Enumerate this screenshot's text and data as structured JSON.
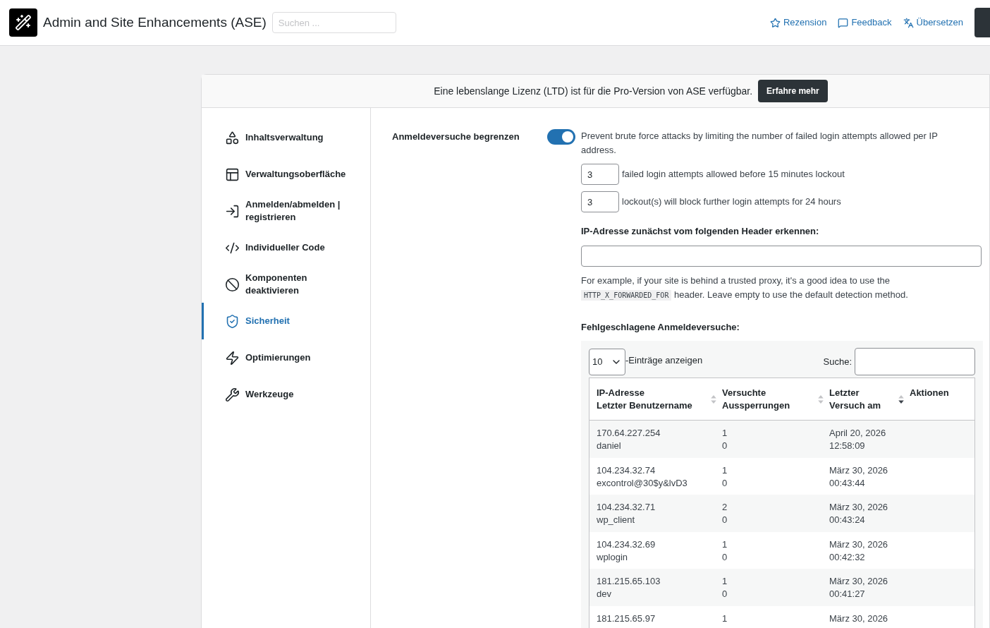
{
  "header": {
    "title": "Admin and Site Enhancements (ASE)",
    "search": {
      "placeholder": "Suchen ..."
    },
    "links": [
      "Rezension",
      "Feedback",
      "Übersetzen"
    ]
  },
  "banner": {
    "text": "Eine lebenslange Lizenz (LTD) ist für die Pro-Version von ASE verfügbar.",
    "button": "Erfahre mehr"
  },
  "sidebar": {
    "items": [
      {
        "label": "Inhaltsverwaltung",
        "selected": false
      },
      {
        "label": "Verwaltungsoberfläche",
        "selected": false
      },
      {
        "label": "Anmelden/abmelden | registrieren",
        "selected": false
      },
      {
        "label": "Individueller Code",
        "selected": false
      },
      {
        "label": "Komponenten deaktivieren",
        "selected": false
      },
      {
        "label": "Sicherheit",
        "selected": true
      },
      {
        "label": "Optimierungen",
        "selected": false
      },
      {
        "label": "Werkzeuge",
        "selected": false
      }
    ]
  },
  "setting": {
    "label": "Anmeldeversuche begrenzen",
    "on": true,
    "description": "Prevent brute force attacks by limiting the number of failed login attempts allowed per IP address.",
    "fields": [
      {
        "value": "3",
        "text": "failed login attempts allowed before 15 minutes lockout"
      },
      {
        "value": "3",
        "text": "lockout(s) will block further login attempts for 24 hours"
      }
    ],
    "header_label": "IP-Adresse zunächst vom folgenden Header erkennen:",
    "help_before": "For example, if your site is behind a trusted proxy, it's a good idea to use the",
    "help_code": "HTTP_X_FORWARDED_FOR",
    "help_after": "header. Leave empty to use the default detection method.",
    "table_label": "Fehlgeschlagene Anmeldeversuche:"
  },
  "table": {
    "page_size": "10",
    "page_size_label": "-Einträge anzeigen",
    "search_label": "Suche:",
    "columns": [
      {
        "lines": [
          "IP-Adresse",
          "Letzter Benutzername"
        ],
        "sortable": true,
        "sorted": false
      },
      {
        "lines": [
          "Versuchte",
          "Aussperrungen"
        ],
        "sortable": true,
        "sorted": false
      },
      {
        "lines": [
          "Letzter",
          "Versuch am"
        ],
        "sortable": true,
        "sorted": true
      },
      {
        "lines": [
          "Aktionen"
        ]
      }
    ],
    "rows": [
      {
        "ip": "170.64.227.254",
        "user": "daniel",
        "attempts": "1",
        "lockouts": "0",
        "date": "April 20, 2026",
        "time": "12:58:09"
      },
      {
        "ip": "104.234.32.74",
        "user": "excontrol@30$y&lvD3",
        "attempts": "1",
        "lockouts": "0",
        "date": "März 30, 2026",
        "time": "00:43:44"
      },
      {
        "ip": "104.234.32.71",
        "user": "wp_client",
        "attempts": "2",
        "lockouts": "0",
        "date": "März 30, 2026",
        "time": "00:43:24"
      },
      {
        "ip": "104.234.32.69",
        "user": "wplogin",
        "attempts": "1",
        "lockouts": "0",
        "date": "März 30, 2026",
        "time": "00:42:32"
      },
      {
        "ip": "181.215.65.103",
        "user": "dev",
        "attempts": "1",
        "lockouts": "0",
        "date": "März 30, 2026",
        "time": "00:41:27"
      },
      {
        "ip": "181.215.65.97",
        "attempts": "1",
        "date": "März 30, 2026"
      }
    ]
  }
}
